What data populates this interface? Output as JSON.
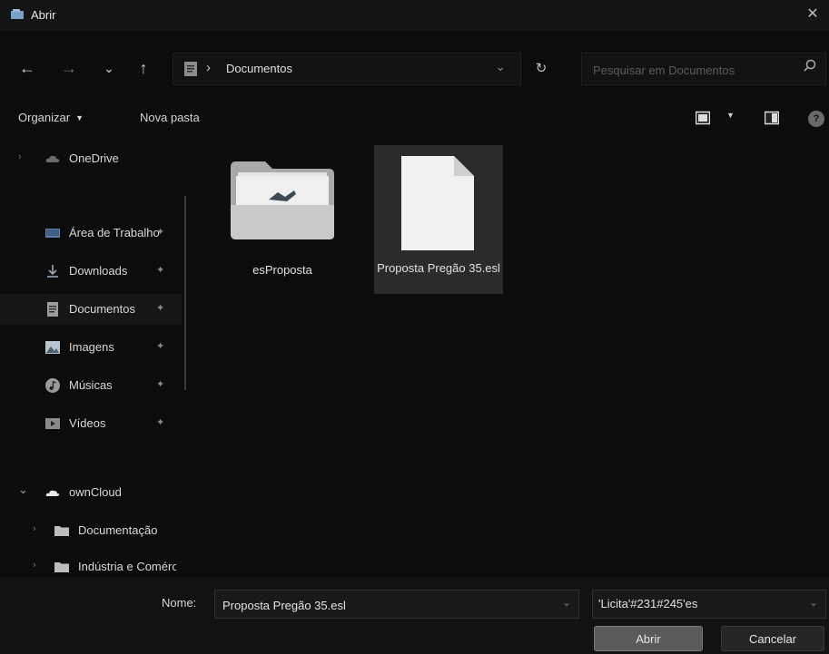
{
  "window": {
    "title": "Abrir",
    "close_glyph": "✕"
  },
  "nav": {
    "back_glyph": "←",
    "forward_glyph": "→",
    "recent_glyph": "⌄",
    "up_glyph": "↑",
    "address": {
      "separator": "›",
      "current_folder": "Documentos",
      "dropdown_glyph": "⌄"
    },
    "refresh_glyph": "↻",
    "search": {
      "placeholder": "Pesquisar em Documentos",
      "value": ""
    }
  },
  "toolbar": {
    "organize_label": "Organizar",
    "organize_caret": "▼",
    "new_folder_label": "Nova pasta",
    "view_caret": "▼",
    "help_label": "?"
  },
  "sidebar": {
    "items": [
      {
        "label": "OneDrive",
        "chevron": "›",
        "pin": "",
        "icon": "cloud-icon"
      },
      {
        "label": "Área de Trabalho",
        "chevron": "",
        "pin": "✦",
        "icon": "desktop-icon"
      },
      {
        "label": "Downloads",
        "chevron": "",
        "pin": "✦",
        "icon": "download-icon"
      },
      {
        "label": "Documentos",
        "chevron": "",
        "pin": "✦",
        "icon": "document-icon"
      },
      {
        "label": "Imagens",
        "chevron": "",
        "pin": "✦",
        "icon": "pictures-icon"
      },
      {
        "label": "Músicas",
        "chevron": "",
        "pin": "✦",
        "icon": "music-icon"
      },
      {
        "label": "Vídeos",
        "chevron": "",
        "pin": "✦",
        "icon": "video-icon"
      },
      {
        "label": "ownCloud",
        "chevron": "⌄",
        "pin": "",
        "icon": "owncloud-icon"
      },
      {
        "label": "Documentação",
        "chevron": "›",
        "pin": "",
        "icon": "folder-icon"
      },
      {
        "label": "Indústria e Comércio",
        "chevron": "›",
        "pin": "",
        "icon": "folder-icon"
      }
    ]
  },
  "files": [
    {
      "name": "esProposta",
      "type": "folder",
      "selected": false
    },
    {
      "name": "Proposta Pregão 35.esl",
      "type": "file",
      "selected": true
    }
  ],
  "bottom": {
    "name_label": "Nome:",
    "name_value": "Proposta Pregão 35.esl",
    "filter_value": "'Licita'#231#245'es",
    "open_button": "Abrir",
    "cancel_button": "Cancelar"
  },
  "colors": {
    "background": "#0c0c0c",
    "selection": "#2b2b2b",
    "text": "#d8d8d8"
  }
}
